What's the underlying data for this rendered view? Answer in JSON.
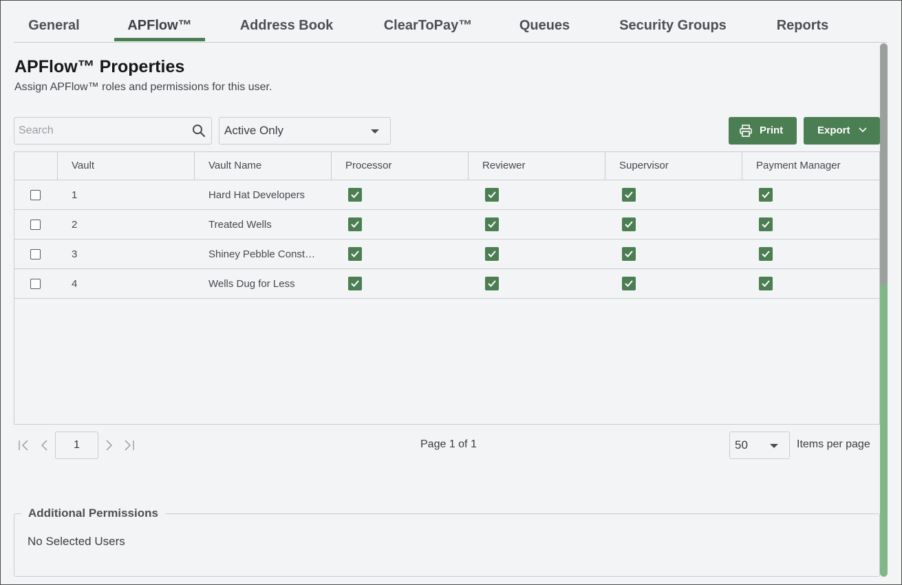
{
  "tabs": [
    {
      "label": "General",
      "active": false
    },
    {
      "label": "APFlow™",
      "active": true
    },
    {
      "label": "Address Book",
      "active": false
    },
    {
      "label": "ClearToPay™",
      "active": false
    },
    {
      "label": "Queues",
      "active": false
    },
    {
      "label": "Security Groups",
      "active": false
    },
    {
      "label": "Reports",
      "active": false
    }
  ],
  "page": {
    "title": "APFlow™ Properties",
    "subtitle": "Assign APFlow™ roles and permissions for this user."
  },
  "toolbar": {
    "search_placeholder": "Search",
    "filter_value": "Active Only",
    "print_label": "Print",
    "export_label": "Export"
  },
  "table": {
    "columns": [
      "Vault",
      "Vault Name",
      "Processor",
      "Reviewer",
      "Supervisor",
      "Payment Manager"
    ],
    "rows": [
      {
        "selected": false,
        "vault": "1",
        "vault_name": "Hard Hat Developers",
        "processor": true,
        "reviewer": true,
        "supervisor": true,
        "payment_manager": true
      },
      {
        "selected": false,
        "vault": "2",
        "vault_name": "Treated Wells",
        "processor": true,
        "reviewer": true,
        "supervisor": true,
        "payment_manager": true
      },
      {
        "selected": false,
        "vault": "3",
        "vault_name": "Shiney Pebble Const…",
        "processor": true,
        "reviewer": true,
        "supervisor": true,
        "payment_manager": true
      },
      {
        "selected": false,
        "vault": "4",
        "vault_name": "Wells Dug for Less",
        "processor": true,
        "reviewer": true,
        "supervisor": true,
        "payment_manager": true
      }
    ]
  },
  "pagination": {
    "current_page": "1",
    "page_info": "Page 1 of 1",
    "items_per_page": "50",
    "items_per_page_label": "Items per page"
  },
  "additional_permissions": {
    "legend": "Additional Permissions",
    "empty_text": "No Selected Users"
  },
  "colors": {
    "accent": "#4b7e52",
    "scrollbar_track": "#7fb886",
    "background": "#f3f4f6"
  },
  "icons": {
    "search": "search-icon",
    "print": "printer-icon",
    "export": "chevron-down-icon",
    "first_page": "first-page-icon",
    "prev_page": "chevron-left-icon",
    "next_page": "chevron-right-icon",
    "last_page": "last-page-icon"
  }
}
